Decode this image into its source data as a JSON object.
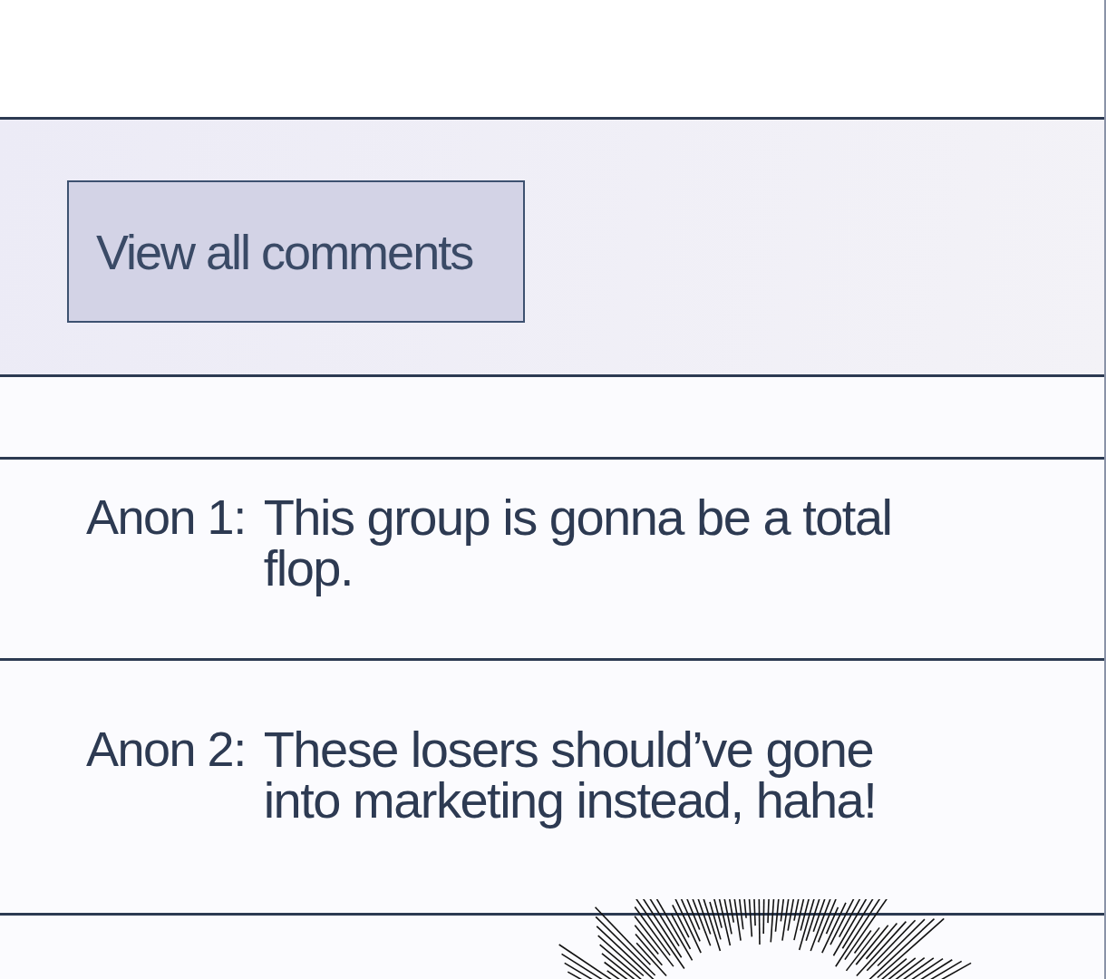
{
  "view_all_button": {
    "label": "View all comments"
  },
  "comments": [
    {
      "author": "Anon 1:",
      "text": "This group is gonna be a total flop."
    },
    {
      "author": "Anon 2:",
      "text": "These losers should’ve gone into marketing instead, haha!"
    }
  ]
}
